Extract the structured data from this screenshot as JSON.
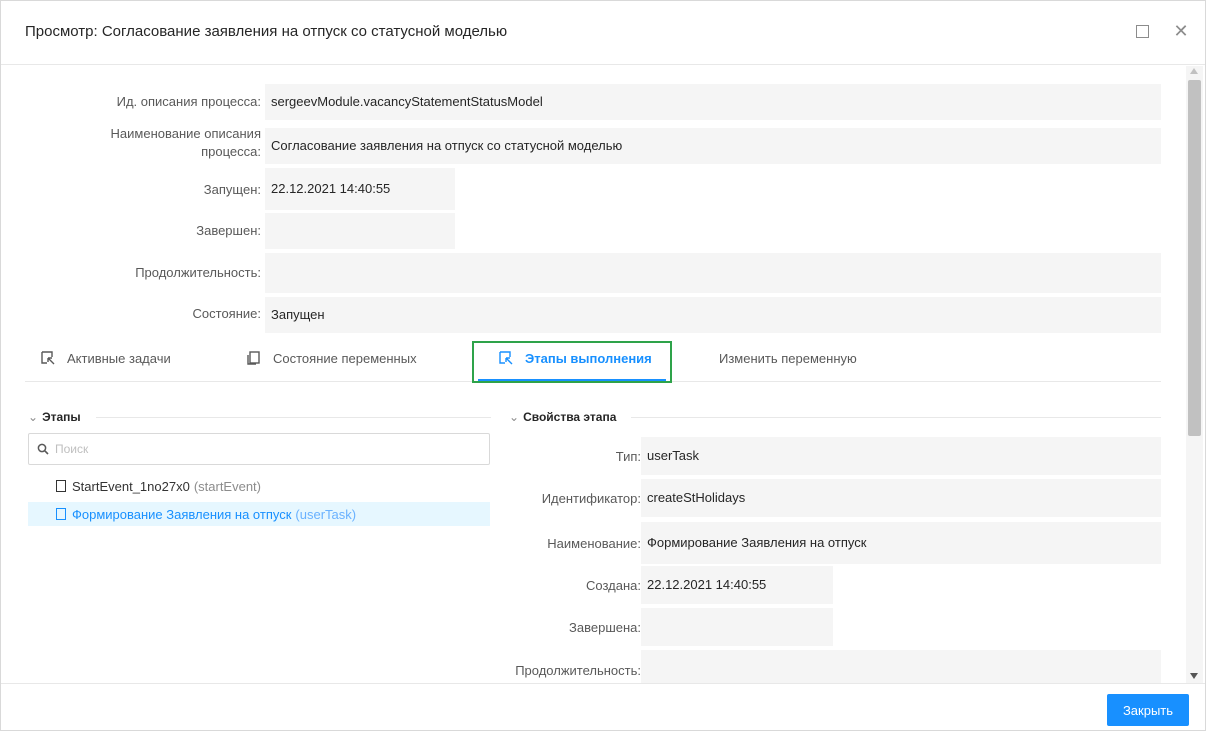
{
  "dialog": {
    "title": "Просмотр: Согласование заявления на отпуск со статусной моделью",
    "maximize_icon": "square-icon",
    "close_icon": "x-icon"
  },
  "process": {
    "id_label": "Ид. описания процесса:",
    "id_value": "sergeevModule.vacancyStatementStatusModel",
    "name_label_line1": "Наименование описания",
    "name_label_line2": "процесса:",
    "name_value": "Согласование заявления на отпуск  со статусной моделью",
    "started_label": "Запущен:",
    "started_value": "22.12.2021 14:40:55",
    "finished_label": "Завершен:",
    "finished_value": "",
    "duration_label": "Продолжительность:",
    "duration_value": "",
    "state_label": "Состояние:",
    "state_value": "Запущен"
  },
  "tabs": [
    {
      "label": "Активные задачи",
      "icon": "select-icon",
      "active": false
    },
    {
      "label": "Состояние переменных",
      "icon": "copy-icon",
      "active": false
    },
    {
      "label": "Этапы выполнения",
      "icon": "select-icon",
      "active": true
    },
    {
      "label": "Изменить переменную",
      "icon": "",
      "active": false
    }
  ],
  "stages": {
    "title": "Этапы",
    "search_placeholder": "Поиск",
    "items": [
      {
        "name": "StartEvent_1no27x0",
        "type": "(startEvent)"
      },
      {
        "name": "Формирование Заявления на отпуск",
        "type": "(userTask)"
      }
    ]
  },
  "stage_props": {
    "title": "Свойства этапа",
    "type_label": "Тип:",
    "type_value": "userTask",
    "id_label": "Идентификатор:",
    "id_value": "createStHolidays",
    "name_label": "Наименование:",
    "name_value": "Формирование Заявления на отпуск",
    "created_label": "Создана:",
    "created_value": "22.12.2021 14:40:55",
    "finished_label": "Завершена:",
    "finished_value": "",
    "duration_label": "Продолжительность:",
    "duration_value": ""
  },
  "footer": {
    "close_label": "Закрыть"
  },
  "colors": {
    "accent": "#1890ff",
    "highlight_box": "#2ea34a",
    "field_bg": "#f5f5f5"
  }
}
